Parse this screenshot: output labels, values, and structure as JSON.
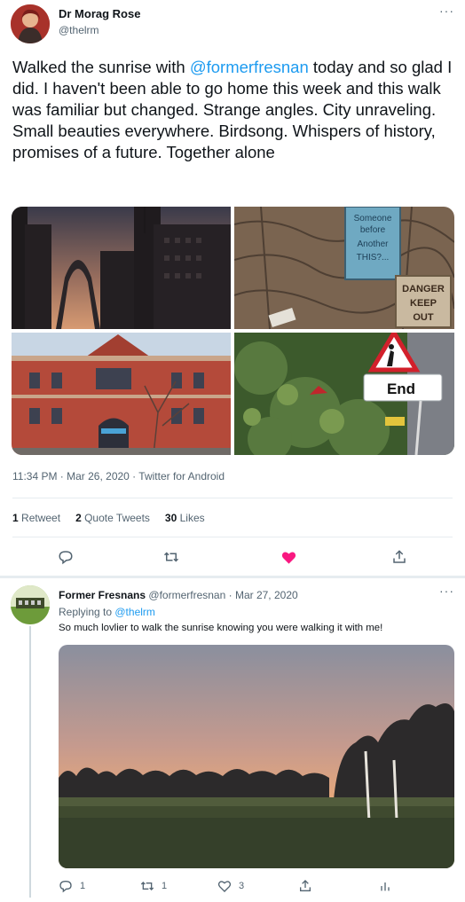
{
  "tweet": {
    "author_name": "Dr Morag Rose",
    "author_handle": "@thelrm",
    "more_icon": "ellipsis-icon",
    "text_before_mention": "Walked the sunrise with ",
    "mention": "@formerfresnan",
    "text_after_mention": " today and so glad I did. I haven't been able to go home this week and this walk was familiar but changed. Strange angles. City unraveling. Small beauties everywhere. Birdsong. Whispers of history, promises of a future. Together alone",
    "photo_sign_text": [
      "Someone",
      "before",
      "Another",
      "THIS?..."
    ],
    "danger_sign": [
      "DANGER",
      "KEEP",
      "OUT"
    ],
    "road_sign_text": "End",
    "timestamp": "11:34 PM · Mar 26, 2020 · Twitter for Android",
    "stats": {
      "retweets_count": "1",
      "retweets_label": "Retweet",
      "quotes_count": "2",
      "quotes_label": "Quote Tweets",
      "likes_count": "30",
      "likes_label": "Likes"
    },
    "actions": [
      "reply-icon",
      "retweet-icon",
      "like-icon-filled",
      "share-icon"
    ],
    "like_color": "#f91880"
  },
  "reply": {
    "author_name": "Former Fresnans",
    "author_handle": "@formerfresnan",
    "date": "· Mar 27, 2020",
    "replying_prefix": "Replying to ",
    "replying_to": "@thelrm",
    "text": "So much lovlier to walk the sunrise knowing you were walking it with me!",
    "actions": {
      "reply_count": "1",
      "retweet_count": "1",
      "like_count": "3"
    }
  },
  "colors": {
    "link": "#1d9bf0",
    "muted": "#536471",
    "text": "#0f1419"
  }
}
